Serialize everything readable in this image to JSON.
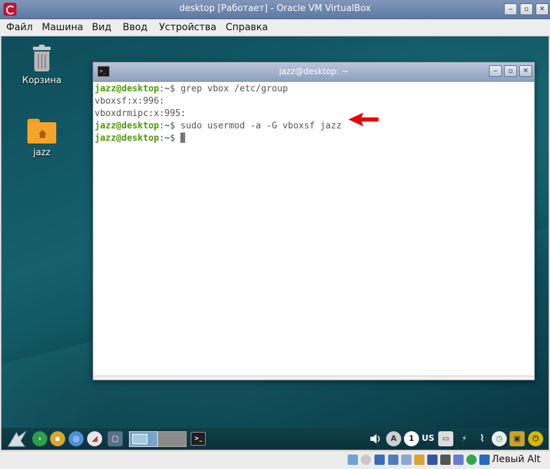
{
  "vbox": {
    "title": "desktop [Работает] - Oracle VM VirtualBox",
    "menu": [
      "Файл",
      "Машина",
      "Вид",
      "Ввод",
      "Устройства",
      "Справка"
    ],
    "window_buttons": [
      "‒",
      "▫",
      "✕"
    ],
    "host_key": "Левый Alt"
  },
  "desktop": {
    "icons": [
      {
        "label": "Корзина",
        "icon": "trash-icon"
      },
      {
        "label": "jazz",
        "icon": "home-folder-icon"
      }
    ]
  },
  "terminal": {
    "title": "jazz@desktop: ~",
    "app_icon_text": ">_",
    "window_buttons": [
      "‒",
      "▫",
      "✕"
    ],
    "lines": [
      {
        "user": "jazz@desktop",
        "sep": ":",
        "path": "~",
        "sym": "$ ",
        "cmd": "grep vbox /etc/group"
      },
      {
        "output": "vboxsf:x:996:"
      },
      {
        "output": "vboxdrmipc:x:995:"
      },
      {
        "user": "jazz@desktop",
        "sep": ":",
        "path": "~",
        "sym": "$ ",
        "cmd": "sudo usermod -a -G vboxsf jazz"
      },
      {
        "user": "jazz@desktop",
        "sep": ":",
        "path": "~",
        "sym": "$ ",
        "cmd": ""
      }
    ],
    "annotation_color": "#e8000b"
  },
  "taskbar": {
    "tray_letter_a": "A",
    "tray_number": "1",
    "keyboard_layout": "US"
  }
}
